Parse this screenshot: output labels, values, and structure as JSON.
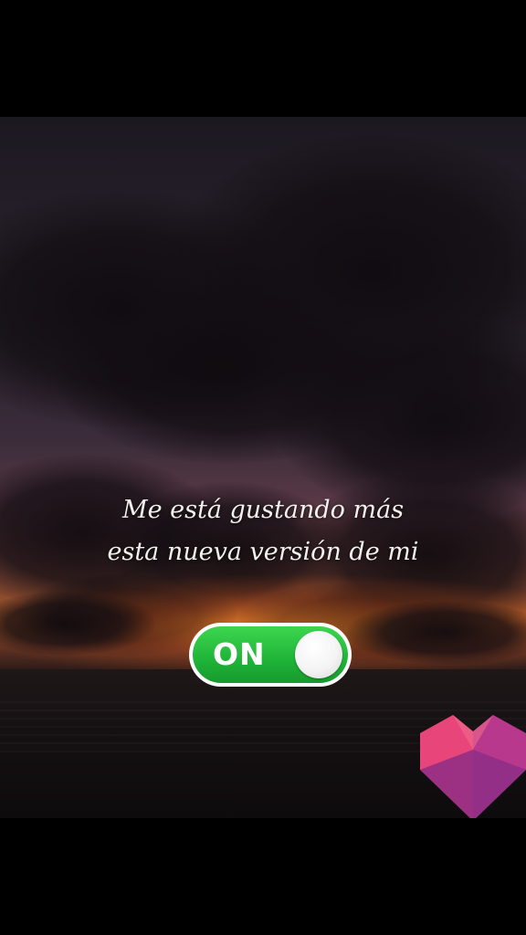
{
  "caption": {
    "line1": "Me está gustando más",
    "line2": "esta nueva versión de mi"
  },
  "toggle": {
    "label": "ON",
    "state": "on",
    "color": "#1fb338"
  },
  "logo": {
    "icon": "heart-logo-icon",
    "colors": [
      "#e8467a",
      "#c53a8a",
      "#8e2e86"
    ]
  }
}
